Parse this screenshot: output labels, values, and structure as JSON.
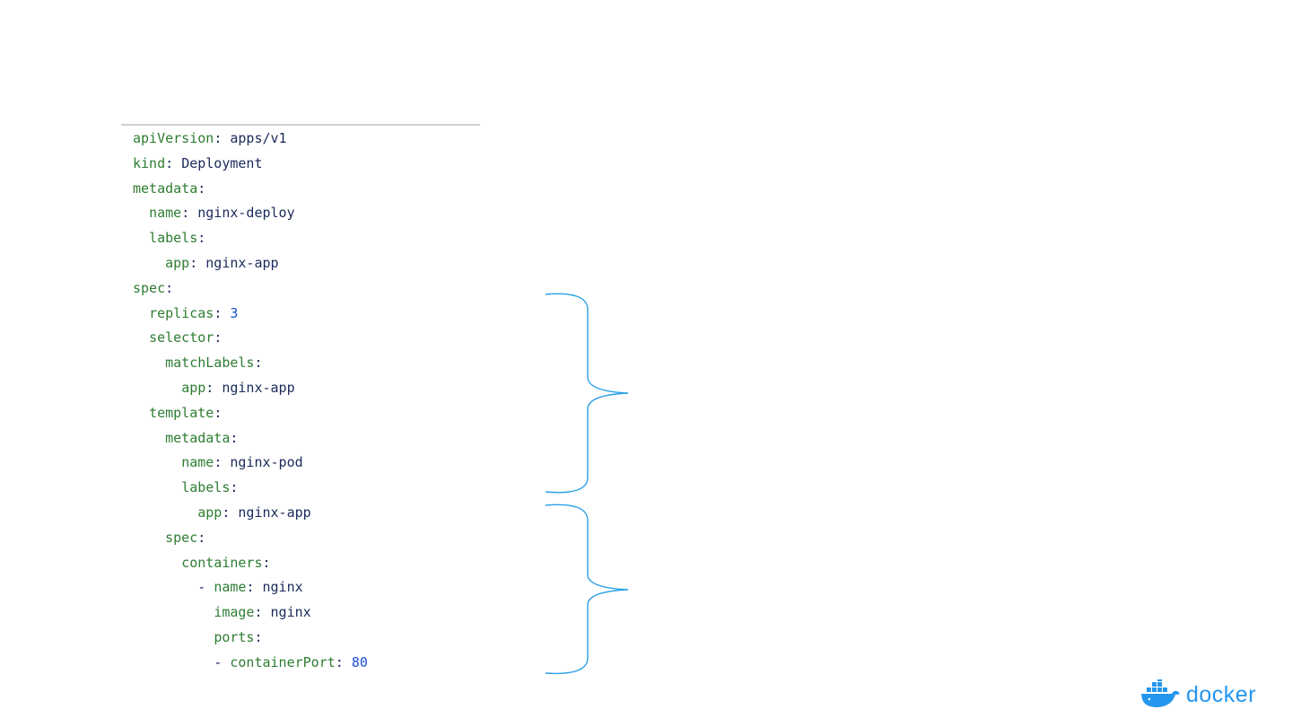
{
  "code": {
    "lines": [
      {
        "indent": "",
        "dash": "",
        "key": "apiVersion",
        "value": "apps/v1",
        "value_type": "str"
      },
      {
        "indent": "",
        "dash": "",
        "key": "kind",
        "value": "Deployment",
        "value_type": "str"
      },
      {
        "indent": "",
        "dash": "",
        "key": "metadata",
        "value": "",
        "value_type": "none"
      },
      {
        "indent": "  ",
        "dash": "",
        "key": "name",
        "value": "nginx-deploy",
        "value_type": "str"
      },
      {
        "indent": "  ",
        "dash": "",
        "key": "labels",
        "value": "",
        "value_type": "none"
      },
      {
        "indent": "    ",
        "dash": "",
        "key": "app",
        "value": "nginx-app",
        "value_type": "str"
      },
      {
        "indent": "",
        "dash": "",
        "key": "spec",
        "value": "",
        "value_type": "none"
      },
      {
        "indent": "  ",
        "dash": "",
        "key": "replicas",
        "value": "3",
        "value_type": "num"
      },
      {
        "indent": "  ",
        "dash": "",
        "key": "selector",
        "value": "",
        "value_type": "none"
      },
      {
        "indent": "    ",
        "dash": "",
        "key": "matchLabels",
        "value": "",
        "value_type": "none"
      },
      {
        "indent": "      ",
        "dash": "",
        "key": "app",
        "value": "nginx-app",
        "value_type": "str"
      },
      {
        "indent": "  ",
        "dash": "",
        "key": "template",
        "value": "",
        "value_type": "none"
      },
      {
        "indent": "    ",
        "dash": "",
        "key": "metadata",
        "value": "",
        "value_type": "none"
      },
      {
        "indent": "      ",
        "dash": "",
        "key": "name",
        "value": "nginx-pod",
        "value_type": "str"
      },
      {
        "indent": "      ",
        "dash": "",
        "key": "labels",
        "value": "",
        "value_type": "none"
      },
      {
        "indent": "        ",
        "dash": "",
        "key": "app",
        "value": "nginx-app",
        "value_type": "str"
      },
      {
        "indent": "    ",
        "dash": "",
        "key": "spec",
        "value": "",
        "value_type": "none"
      },
      {
        "indent": "      ",
        "dash": "",
        "key": "containers",
        "value": "",
        "value_type": "none"
      },
      {
        "indent": "        ",
        "dash": "- ",
        "key": "name",
        "value": "nginx",
        "value_type": "str"
      },
      {
        "indent": "          ",
        "dash": "",
        "key": "image",
        "value": "nginx",
        "value_type": "str"
      },
      {
        "indent": "          ",
        "dash": "",
        "key": "ports",
        "value": "",
        "value_type": "none"
      },
      {
        "indent": "          ",
        "dash": "- ",
        "key": "containerPort",
        "value": "80",
        "value_type": "num"
      }
    ]
  },
  "colors": {
    "key": "#2e7d32",
    "text": "#1a2a5a",
    "number": "#1a4fd6",
    "brace": "#2aa0e6",
    "brand": "#2496ed"
  },
  "logo": {
    "text": "docker",
    "icon": "docker-whale-icon"
  }
}
